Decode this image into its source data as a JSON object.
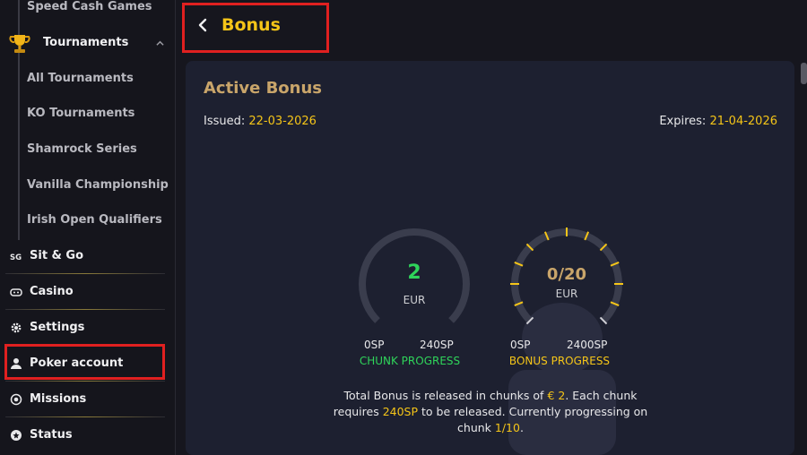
{
  "colors": {
    "accent": "#f5c518",
    "green": "#2fd45a",
    "highlight": "#e02020",
    "title_gold": "#c9a56a"
  },
  "sidebar": {
    "partial_top": "Speed Cash Games",
    "tournaments": {
      "label": "Tournaments",
      "icon": "trophy-icon",
      "expanded": true
    },
    "sub_items": [
      {
        "label": "All Tournaments"
      },
      {
        "label": "KO Tournaments"
      },
      {
        "label": "Shamrock Series"
      },
      {
        "label": "Vanilla Championship"
      },
      {
        "label": "Irish Open Qualifiers"
      }
    ],
    "main_items": [
      {
        "label": "Sit & Go",
        "icon": "sit-and-go-icon"
      },
      {
        "label": "Casino",
        "icon": "gamepad-icon"
      },
      {
        "label": "Settings",
        "icon": "gear-icon"
      },
      {
        "label": "Poker account",
        "icon": "user-icon",
        "highlighted": true
      },
      {
        "label": "Missions",
        "icon": "target-icon"
      },
      {
        "label": "Status",
        "icon": "badge-icon"
      }
    ]
  },
  "header": {
    "title": "Bonus",
    "back_icon": "chevron-left-icon"
  },
  "bonus": {
    "card_title": "Active Bonus",
    "issued_label": "Issued:",
    "issued_date": "22-03-2026",
    "expires_label": "Expires:",
    "expires_date": "21-04-2026",
    "chunk": {
      "value": "2",
      "unit": "EUR",
      "min": "0SP",
      "max": "240SP",
      "label": "CHUNK PROGRESS",
      "progress_fraction": 0.0
    },
    "total": {
      "value": "0/20",
      "unit": "EUR",
      "min": "0SP",
      "max": "2400SP",
      "label": "BONUS PROGRESS",
      "progress_fraction": 0.0,
      "segments": 20
    },
    "description": {
      "part1": "Total Bonus is released in chunks of ",
      "amount": "€ 2",
      "part2": ". Each chunk requires ",
      "sp": "240SP",
      "part3": " to be released. Currently progressing on chunk ",
      "chunk": "1/10",
      "part4": "."
    }
  }
}
